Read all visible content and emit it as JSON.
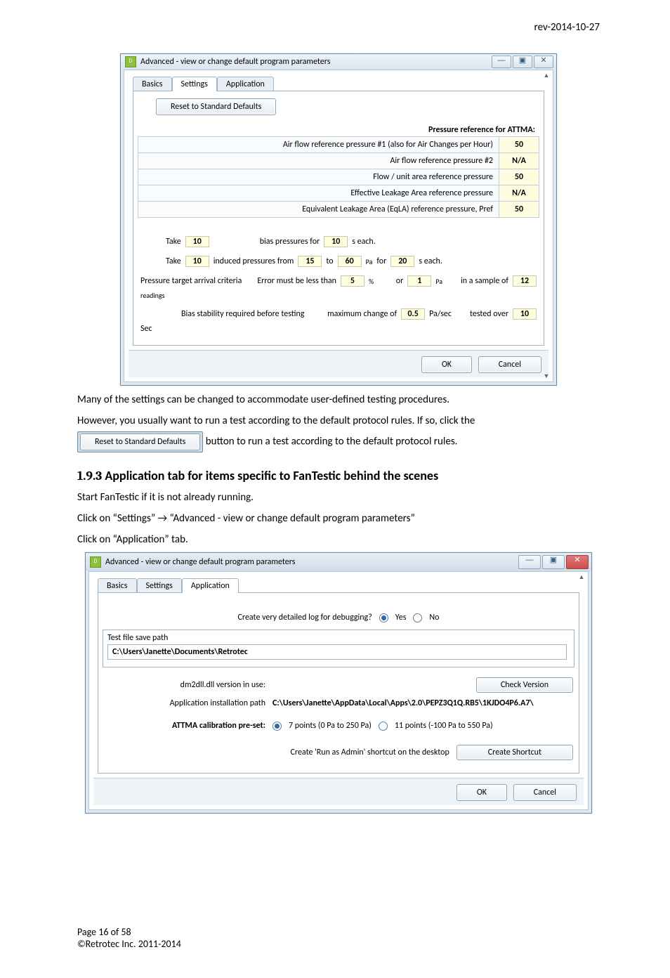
{
  "rev": "rev-2014-10-27",
  "win1": {
    "title": "Advanced - view or change default program parameters",
    "tabs": {
      "basics": "Basics",
      "settings": "Settings",
      "application": "Application"
    },
    "reset_btn": "Reset to Standard Defaults",
    "pref_heading": "Pressure reference for ATTMA:",
    "rows": [
      {
        "label": "Air flow reference pressure #1 (also for Air Changes per Hour)",
        "val": "50"
      },
      {
        "label": "Air flow reference pressure #2",
        "val": "N/A"
      },
      {
        "label": "Flow / unit area reference pressure",
        "val": "50"
      },
      {
        "label": "Effective Leakage Area reference pressure",
        "val": "N/A"
      },
      {
        "label": "Equivalent Leakage Area (EqLA) reference pressure, Pref",
        "val": "50"
      }
    ],
    "line1": {
      "take": "Take",
      "v1": "10",
      "bias": "bias pressures for",
      "v2": "10",
      "each": "s each."
    },
    "line2": {
      "take": "Take",
      "v1": "10",
      "ind": "induced pressures from",
      "v2": "15",
      "to": "to",
      "v3": "60",
      "pa": "Pa",
      "for": "for",
      "v4": "20",
      "each": "s each."
    },
    "line3": {
      "crit": "Pressure target arrival criteria",
      "err": "Error must be less than",
      "v1": "5",
      "pct": "%",
      "or": "or",
      "v2": "1",
      "pa": "Pa",
      "samp": "in a sample of",
      "v3": "12",
      "rd": "readings"
    },
    "line4": {
      "bias": "Bias stability required before testing",
      "max": "maximum change of",
      "v1": "0.5",
      "pas": "Pa/sec",
      "tested": "tested over",
      "v2": "10",
      "sec": "Sec"
    },
    "ok": "OK",
    "cancel": "Cancel"
  },
  "para1": "Many of the settings can be changed to accommodate user-defined testing procedures.",
  "para2": "However, you usually want to run a test according to the default protocol rules.  If so, click the ",
  "inline_reset": "Reset to Standard Defaults",
  "para2b": " button to run a test according to the default protocol rules.",
  "section_num": "1.9.3",
  "section_title": "Application tab for items specific to FanTestic behind the scenes",
  "para3": "Start FanTestic if it is not already running.",
  "para4a": "Click on “Settings” ",
  "arrow": "→",
  "para4b": " “Advanced - view or change default program parameters”",
  "para5": "Click on “Application” tab.",
  "win2": {
    "title": "Advanced - view or change default program parameters",
    "tabs": {
      "basics": "Basics",
      "settings": "Settings",
      "application": "Application"
    },
    "debug_q": "Create very detailed log for debugging?",
    "yes": "Yes",
    "no": "No",
    "save_path_lbl": "Test file save path",
    "save_path_val": "C:\\Users\\Janette\\Documents\\Retrotec",
    "dll_lbl": "dm2dll.dll version in use:",
    "check_btn": "Check Version",
    "install_lbl": "Application installation path",
    "install_val": "C:\\Users\\Janette\\AppData\\Local\\Apps\\2.0\\PEPZ3Q1Q.RB5\\1KJDO4P6.A7\\",
    "attma_lbl": "ATTMA calibration pre-set:",
    "opt7": "7 points (0 Pa to 250 Pa)",
    "opt11": "11 points (-100 Pa to 550 Pa)",
    "shortcut_lbl": "Create 'Run as Admin' shortcut on the desktop",
    "shortcut_btn": "Create Shortcut",
    "ok": "OK",
    "cancel": "Cancel"
  },
  "footer": {
    "page": "Page 16 of 58",
    "copy": "©Retrotec Inc. 2011-2014"
  }
}
